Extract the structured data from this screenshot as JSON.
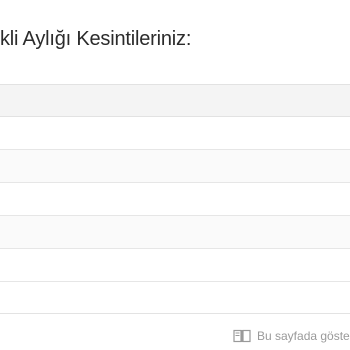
{
  "heading": {
    "title": "kli Aylığı Kesintileriniz:"
  },
  "table": {
    "rows": [
      "",
      "",
      "",
      "",
      "",
      ""
    ]
  },
  "footer": {
    "note": "Bu sayfada göste",
    "icon": "book-icon"
  }
}
